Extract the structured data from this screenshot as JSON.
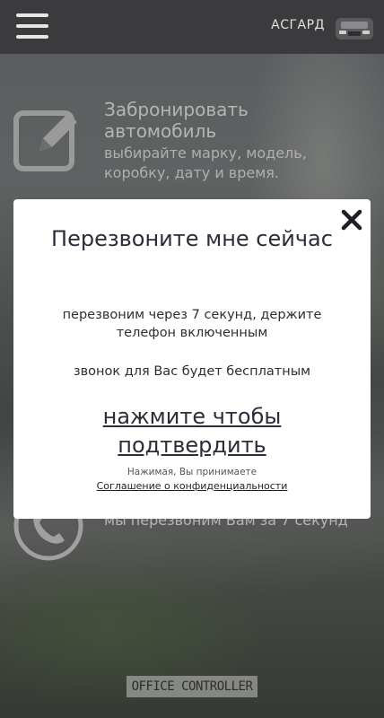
{
  "header": {
    "brand": "АСГАРД",
    "menu_icon": "hamburger-icon",
    "avatar_icon": "car-avatar-icon"
  },
  "background": {
    "booking": {
      "title": "Забронировать автомобиль",
      "subtitle": "выбирайте марку, модель, коробку, дату и время.",
      "icon": "edit-icon"
    },
    "callback": {
      "subtitle": "мы перезвоним Вам за 7 секунд",
      "icon": "phone-icon"
    }
  },
  "modal": {
    "title": "Перезвоните мне сейчас",
    "text1": "перезвоним через 7 секунд, держите телефон включенным",
    "text2": "звонок для Вас будет бесплатным",
    "confirm_link": "нажмите чтобы подтвердить",
    "agreement_note": "Нажимая, Вы принимаете",
    "policy_link": "Соглашение о конфиденциальности",
    "close_icon": "close-icon"
  },
  "footer": {
    "badge": "OFFICE CONTROLLER"
  }
}
